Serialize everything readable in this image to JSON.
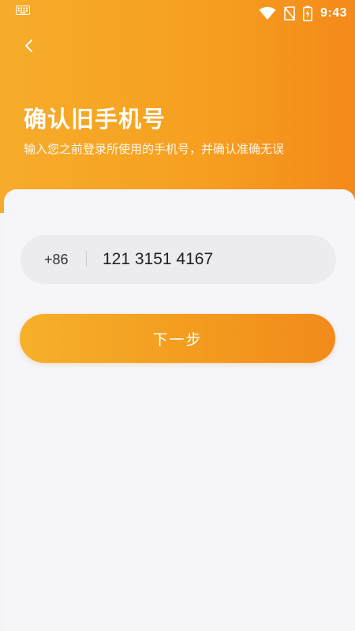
{
  "status_bar": {
    "time": "9:43",
    "icons": [
      "keyboard-icon",
      "wifi-icon",
      "no-sim-icon",
      "battery-charging-icon"
    ]
  },
  "header": {
    "back_icon": "chevron-left-icon",
    "title": "确认旧手机号",
    "subtitle": "输入您之前登录所使用的手机号，并确认准确无误"
  },
  "form": {
    "country_code": "+86",
    "phone_value": "121 3151 4167",
    "next_label": "下一步"
  },
  "colors": {
    "accent_start": "#f6ac2a",
    "accent_end": "#f48a1a",
    "input_bg": "#ececf0",
    "page_bg": "#f5f5fa"
  }
}
